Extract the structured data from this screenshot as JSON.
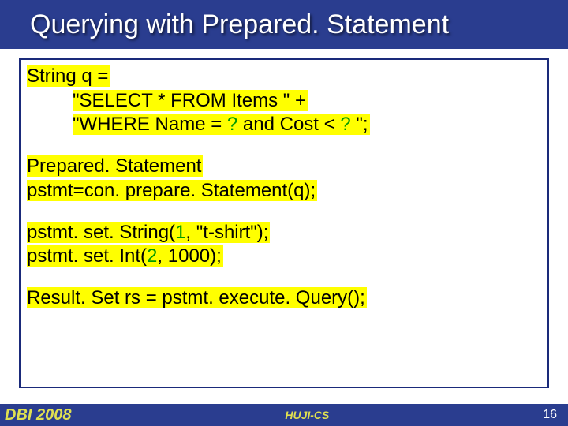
{
  "title": "Querying with Prepared. Statement",
  "code": {
    "b1_l1": "String q = ",
    "b1_l2": "\"SELECT * FROM Items \" +",
    "b1_l3_a": "\"WHERE Name = ",
    "b1_l3_q1": "?",
    "b1_l3_b": " and Cost < ",
    "b1_l3_q2": "?",
    "b1_l3_c": " \";",
    "b2_l1": "Prepared. Statement ",
    "b2_l2": "pstmt=con. prepare. Statement(q);",
    "b3_l1_a": "pstmt. set. String(",
    "b3_l1_n": "1",
    "b3_l1_b": ", \"t-shirt\");",
    "b3_l2_a": "pstmt. set. Int(",
    "b3_l2_n": "2",
    "b3_l2_b": ", 1000);",
    "b4": "Result. Set rs = pstmt. execute. Query();"
  },
  "footer": {
    "left": "DBI 2008",
    "center": "HUJI-CS",
    "right": "16"
  }
}
